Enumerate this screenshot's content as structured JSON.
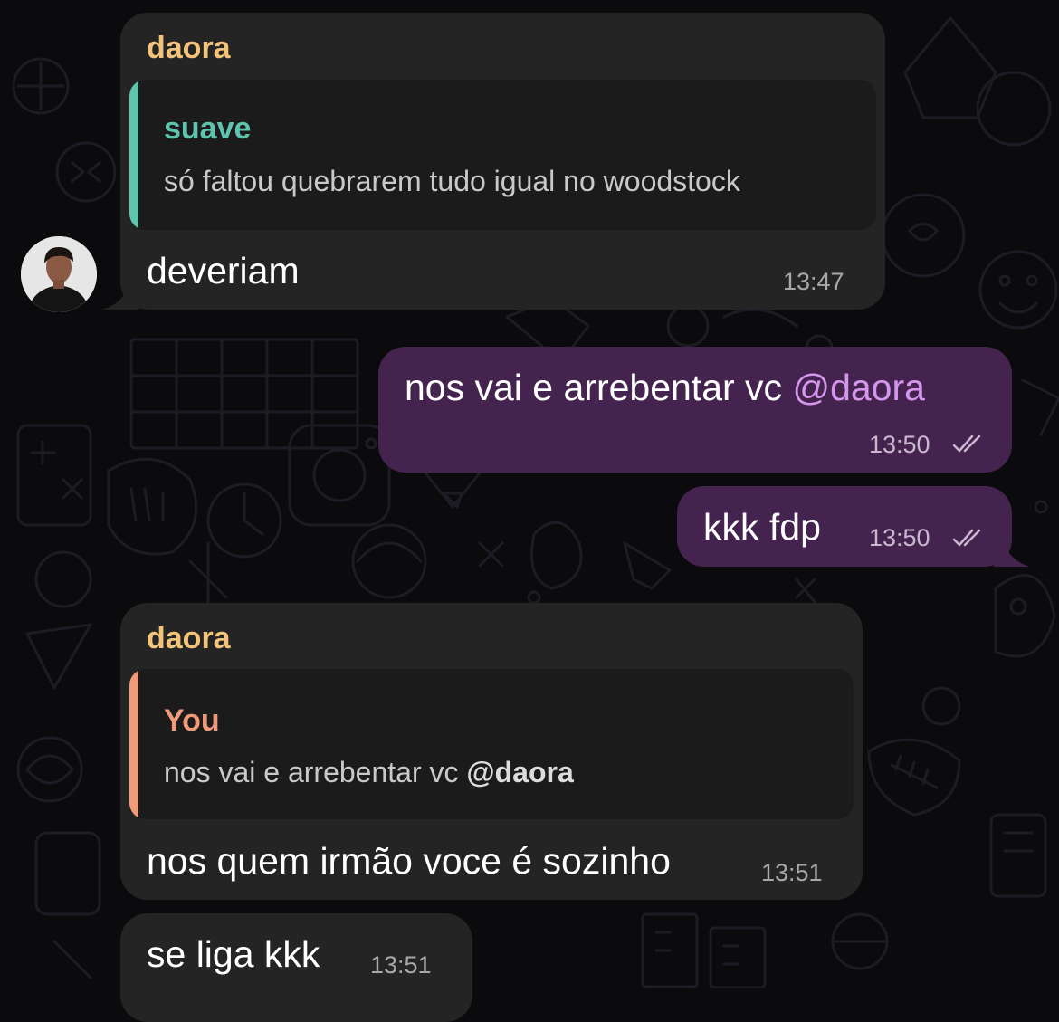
{
  "colors": {
    "background": "#0b0a0d",
    "incoming_bubble": "#242424",
    "outgoing_bubble": "#45234f",
    "sender_name": "#f4c37a",
    "quote_suave": "#5fc4ae",
    "quote_you": "#ef9a78",
    "mention": "#d596ee"
  },
  "messages": [
    {
      "direction": "incoming",
      "sender": "daora",
      "quote": {
        "author": "suave",
        "text": "só faltou quebrarem tudo igual no woodstock"
      },
      "text": "deveriam",
      "time": "13:47",
      "avatar": "avatar-daora"
    },
    {
      "direction": "outgoing",
      "text_prefix": "nos vai e arrebentar vc ",
      "mention": "@daora",
      "time": "13:50",
      "status_icon": "double-check-icon"
    },
    {
      "direction": "outgoing",
      "text": "kkk fdp",
      "time": "13:50",
      "status_icon": "double-check-icon"
    },
    {
      "direction": "incoming",
      "sender": "daora",
      "quote": {
        "author": "You",
        "text_prefix": "nos vai e arrebentar vc ",
        "mention": "@daora"
      },
      "text": "nos quem irmão voce é sozinho",
      "time": "13:51"
    },
    {
      "direction": "incoming",
      "text": "se liga kkk",
      "time": "13:51"
    }
  ]
}
